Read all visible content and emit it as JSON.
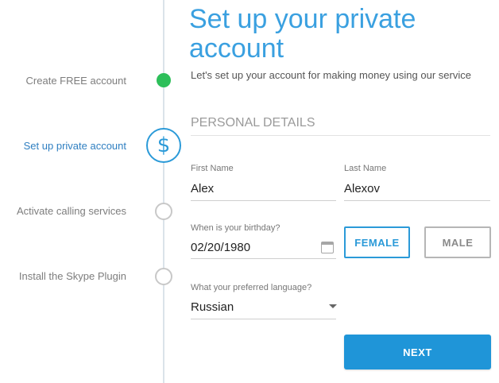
{
  "steps": [
    {
      "label": "Create FREE account",
      "state": "done"
    },
    {
      "label": "Set up private account",
      "state": "active",
      "icon": "dollar-icon",
      "glyph": "$"
    },
    {
      "label": "Activate calling services",
      "state": "todo"
    },
    {
      "label": "Install the Skype Plugin",
      "state": "todo"
    }
  ],
  "header": {
    "title": "Set up your private account",
    "subtitle": "Let's set up your account for making money using our service"
  },
  "section_title": "PERSONAL DETAILS",
  "form": {
    "first_name": {
      "label": "First Name",
      "value": "Alex"
    },
    "last_name": {
      "label": "Last Name",
      "value": "Alexov"
    },
    "birthday": {
      "label": "When is your birthday?",
      "value": "02/20/1980",
      "icon": "calendar-icon"
    },
    "gender": {
      "female_label": "FEMALE",
      "male_label": "MALE",
      "selected": "FEMALE"
    },
    "language": {
      "label": "What your preferred language?",
      "value": "Russian",
      "icon": "chevron-down-icon"
    }
  },
  "next_label": "NEXT",
  "colors": {
    "accent": "#2b9ad8",
    "done": "#2dbf5a",
    "button": "#1f95d8"
  }
}
